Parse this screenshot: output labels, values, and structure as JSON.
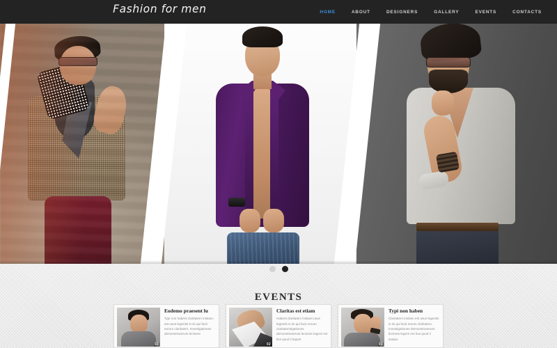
{
  "site": {
    "logo": "Fashion for men",
    "accent_color": "#3f8ddb",
    "header_bg": "#232323"
  },
  "nav": {
    "items": [
      {
        "label": "HOME",
        "active": true
      },
      {
        "label": "ABOUT",
        "active": false
      },
      {
        "label": "DESIGNERS",
        "active": false
      },
      {
        "label": "GALLERY",
        "active": false
      },
      {
        "label": "EVENTS",
        "active": false
      },
      {
        "label": "CONTACTS",
        "active": false
      }
    ]
  },
  "hero": {
    "slides": [
      {
        "name": "man-in-tan-blazer-street"
      },
      {
        "name": "man-in-purple-shirt-studio"
      },
      {
        "name": "bearded-man-in-grey-sweater"
      }
    ],
    "pagination": [
      {
        "label": "1",
        "active": false
      },
      {
        "label": "2",
        "active": true
      }
    ]
  },
  "events": {
    "title": "EVENTS",
    "cards": [
      {
        "title": "Eodemo praesent lu",
        "text": "Typi non habent claritatem insitam; est usus legentis in iis qui facit eorum claritatem. Investigationes demonstraverunt lectores",
        "thumb_number": "03"
      },
      {
        "title": "Claritas est etiam",
        "text": "Habent claritatem insitant usus legentis in iis qui facit eorum claritatemtigationes demonstraverunt lectores legere me lius quod ii legunt",
        "thumb_number": "02"
      },
      {
        "title": "Typi non haben",
        "text": "Claritatem insitam est usus legentis in iis qui facit eorum claritatem. Investigationes demonstraverunt lectores legere me lius quod ii saepiu",
        "thumb_number": "03"
      }
    ]
  }
}
